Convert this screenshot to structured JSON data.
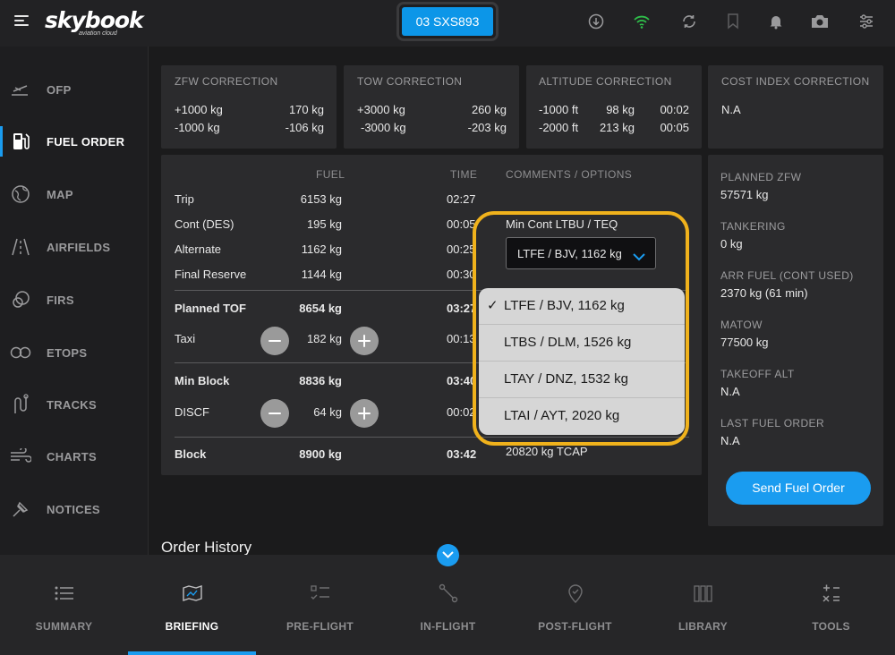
{
  "app": {
    "logo": "skybook",
    "logo_sub": "aviation cloud",
    "flight": "03 SXS893"
  },
  "topbar": {
    "icons": [
      "download-icon",
      "wifi-icon",
      "sync-icon",
      "bookmark-icon",
      "bell-icon",
      "camera-icon",
      "settings-sliders-icon"
    ]
  },
  "sidebar": {
    "items": [
      {
        "label": "OFP",
        "icon": "ofp-icon"
      },
      {
        "label": "FUEL ORDER",
        "icon": "fuel-pump-icon",
        "active": true
      },
      {
        "label": "MAP",
        "icon": "globe-icon"
      },
      {
        "label": "AIRFIELDS",
        "icon": "runway-icon"
      },
      {
        "label": "FIRS",
        "icon": "firs-icon"
      },
      {
        "label": "ETOPS",
        "icon": "etops-icon"
      },
      {
        "label": "TRACKS",
        "icon": "tracks-icon"
      },
      {
        "label": "CHARTS",
        "icon": "wind-icon"
      },
      {
        "label": "NOTICES",
        "icon": "notices-icon"
      }
    ]
  },
  "corrections": {
    "zfw": {
      "title": "ZFW CORRECTION",
      "rows": [
        [
          "+1000 kg",
          "170 kg"
        ],
        [
          "-1000 kg",
          "-106 kg"
        ]
      ]
    },
    "tow": {
      "title": "TOW CORRECTION",
      "rows": [
        [
          "+3000 kg",
          "260 kg"
        ],
        [
          "-3000 kg",
          "-203 kg"
        ]
      ]
    },
    "alt": {
      "title": "ALTITUDE CORRECTION",
      "rows": [
        [
          "-1000 ft",
          "98 kg",
          "00:02"
        ],
        [
          "-2000 ft",
          "213 kg",
          "00:05"
        ]
      ]
    },
    "ci": {
      "title": "COST INDEX CORRECTION",
      "value": "N.A"
    }
  },
  "fuel_table": {
    "headers": {
      "fuel": "FUEL",
      "time": "TIME",
      "comments": "COMMENTS / OPTIONS"
    },
    "rows": [
      {
        "label": "Trip",
        "fuel": "6153 kg",
        "time": "02:27"
      },
      {
        "label": "Cont (DES)",
        "fuel": "195 kg",
        "time": "00:05"
      },
      {
        "label": "Alternate",
        "fuel": "1162 kg",
        "time": "00:25"
      },
      {
        "label": "Final Reserve",
        "fuel": "1144 kg",
        "time": "00:30"
      }
    ],
    "planned_tof": {
      "label": "Planned TOF",
      "fuel": "8654 kg",
      "time": "03:27"
    },
    "taxi": {
      "label": "Taxi",
      "fuel": "182 kg",
      "time": "00:13"
    },
    "min_block": {
      "label": "Min Block",
      "fuel": "8836 kg",
      "time": "03:40"
    },
    "discf": {
      "label": "DISCF",
      "fuel": "64 kg",
      "time": "00:02"
    },
    "block": {
      "label": "Block",
      "fuel": "8900 kg",
      "time": "03:42"
    },
    "block_comment": "20820 kg TCAP",
    "min_cont_label": "Min Cont LTBU / TEQ",
    "alternate_select": "LTFE / BJV, 1162 kg",
    "dropdown_options": [
      "LTFE / BJV, 1162 kg",
      "LTBS / DLM, 1526 kg",
      "LTAY / DNZ, 1532 kg",
      "LTAI / AYT, 2020 kg"
    ],
    "dropdown_selected_check": "✓"
  },
  "summary_panel": [
    {
      "label": "PLANNED ZFW",
      "value": "57571 kg"
    },
    {
      "label": "TANKERING",
      "value": "0 kg"
    },
    {
      "label": "ARR FUEL (CONT USED)",
      "value": "2370 kg (61 min)"
    },
    {
      "label": "MATOW",
      "value": "77500 kg"
    },
    {
      "label": "TAKEOFF ALT",
      "value": "N.A"
    },
    {
      "label": "LAST FUEL ORDER",
      "value": "N.A"
    }
  ],
  "send_button": "Send Fuel Order",
  "order_history_title": "Order History",
  "bottom_tabs": [
    {
      "label": "SUMMARY",
      "icon": "list-icon"
    },
    {
      "label": "BRIEFING",
      "icon": "map-icon",
      "active": true
    },
    {
      "label": "PRE-FLIGHT",
      "icon": "checklist-icon"
    },
    {
      "label": "IN-FLIGHT",
      "icon": "route-icon"
    },
    {
      "label": "POST-FLIGHT",
      "icon": "location-icon"
    },
    {
      "label": "LIBRARY",
      "icon": "books-icon"
    },
    {
      "label": "TOOLS",
      "icon": "calculator-icon"
    }
  ],
  "colors": {
    "accent": "#1a9cf0",
    "highlight": "#f0b21c",
    "wifi": "#2fbf4a"
  }
}
